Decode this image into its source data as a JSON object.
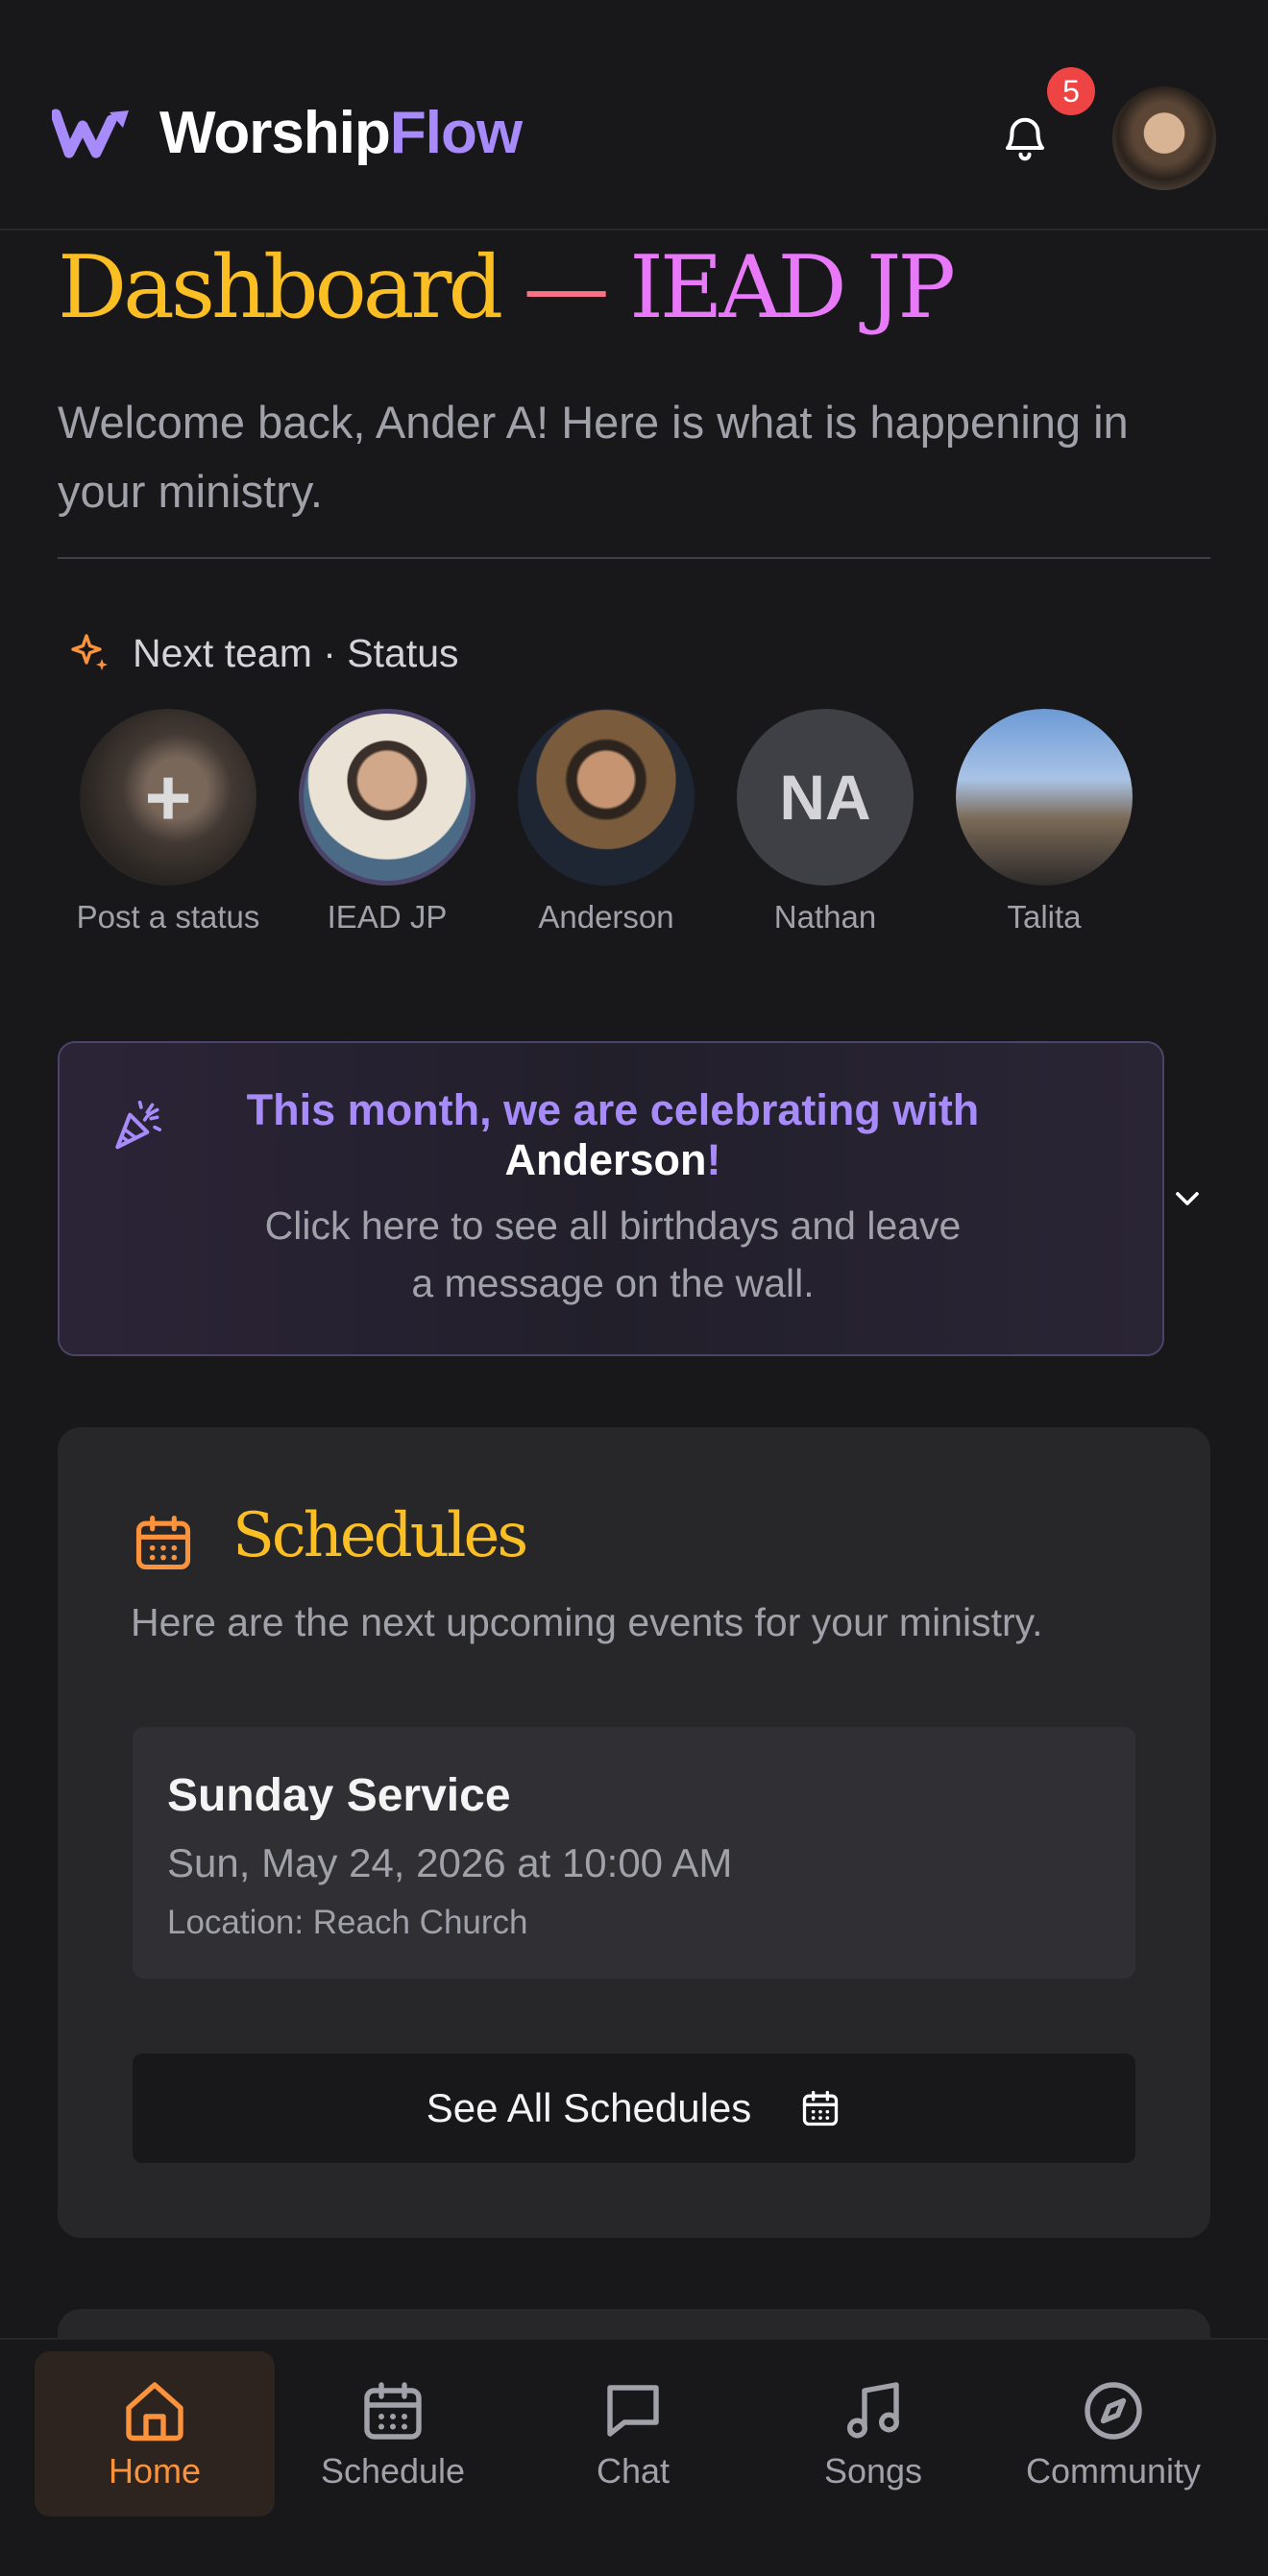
{
  "app": {
    "brand_first": "Worship",
    "brand_second": "Flow",
    "notification_count": "5"
  },
  "page": {
    "title_part1": "Dashboard",
    "title_dash": " — ",
    "title_part2": "IEAD JP",
    "subtitle": "Welcome back, Ander A! Here is what is happening in your ministry."
  },
  "status": {
    "heading": "Next team · Status",
    "stories": [
      {
        "name": "Post a status",
        "initials": ""
      },
      {
        "name": "IEAD JP",
        "initials": ""
      },
      {
        "name": "Anderson",
        "initials": ""
      },
      {
        "name": "Nathan",
        "initials": "NA"
      },
      {
        "name": "Talita",
        "initials": ""
      }
    ]
  },
  "birthday": {
    "line1": "This month, we are celebrating with",
    "name": "Anderson",
    "exclaim": "!",
    "line3": "Click here to see all birthdays and leave a message on the wall."
  },
  "schedules": {
    "heading": "Schedules",
    "description": "Here are the next upcoming events for your ministry.",
    "event": {
      "name": "Sunday Service",
      "datetime": "Sun, May 24, 2026 at 10:00 AM",
      "location": "Location: Reach Church"
    },
    "see_all_label": "See All Schedules"
  },
  "nav": {
    "items": [
      {
        "label": "Home",
        "icon": "home-icon",
        "active": true
      },
      {
        "label": "Schedule",
        "icon": "calendar-icon",
        "active": false
      },
      {
        "label": "Chat",
        "icon": "chat-icon",
        "active": false
      },
      {
        "label": "Songs",
        "icon": "music-icon",
        "active": false
      },
      {
        "label": "Community",
        "icon": "compass-icon",
        "active": false
      }
    ]
  },
  "colors": {
    "background": "#18181b",
    "card": "#27272a",
    "accent_purple": "#a78bfa",
    "accent_orange": "#fb923c",
    "accent_yellow": "#fbbf24",
    "badge_red": "#ef4444"
  }
}
